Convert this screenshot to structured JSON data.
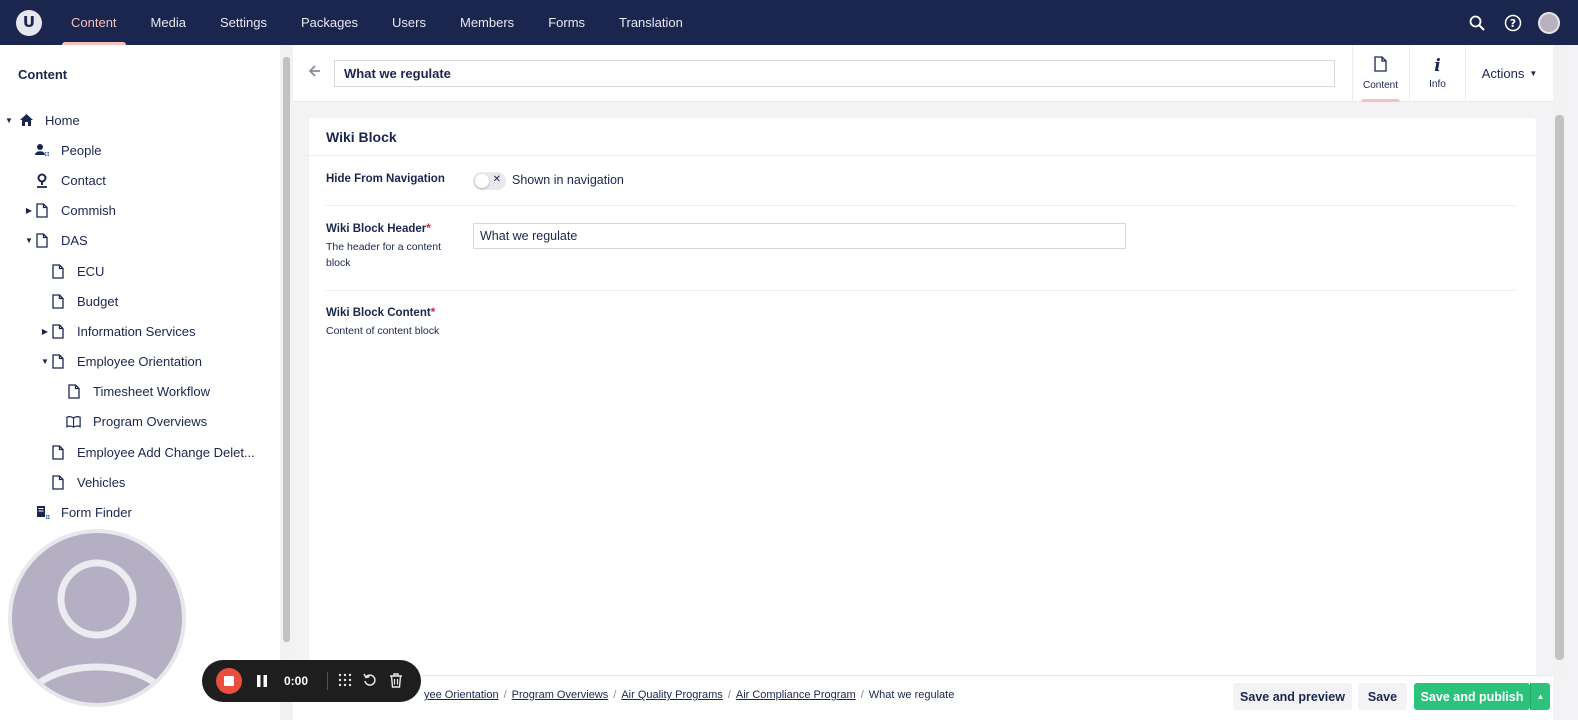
{
  "header": {
    "logo_letter": "U",
    "nav": [
      "Content",
      "Media",
      "Settings",
      "Packages",
      "Users",
      "Members",
      "Forms",
      "Translation"
    ],
    "active_nav": "Content",
    "accent": "#f5c1bc",
    "bar_color": "#1b264f"
  },
  "sidebar": {
    "title": "Content",
    "items": [
      {
        "label": "Home",
        "icon": "home-icon",
        "caret": "down"
      },
      {
        "label": "People",
        "icon": "people-icon",
        "caret": ""
      },
      {
        "label": "Contact",
        "icon": "location-icon",
        "caret": ""
      },
      {
        "label": "Commish",
        "icon": "document-icon",
        "caret": "right"
      },
      {
        "label": "DAS",
        "icon": "document-icon",
        "caret": "down"
      },
      {
        "label": "ECU",
        "icon": "document-icon",
        "caret": ""
      },
      {
        "label": "Budget",
        "icon": "document-icon",
        "caret": ""
      },
      {
        "label": "Information Services",
        "icon": "document-icon",
        "caret": "right"
      },
      {
        "label": "Employee Orientation",
        "icon": "document-icon",
        "caret": "down"
      },
      {
        "label": "Timesheet Workflow",
        "icon": "document-icon",
        "caret": ""
      },
      {
        "label": "Program Overviews",
        "icon": "book-icon",
        "caret": ""
      },
      {
        "label": "Employee Add Change Delet...",
        "icon": "document-icon",
        "caret": ""
      },
      {
        "label": "Vehicles",
        "icon": "document-icon",
        "caret": ""
      },
      {
        "label": "Form Finder",
        "icon": "form-icon",
        "caret": ""
      }
    ]
  },
  "editor": {
    "node_name": "What we regulate",
    "tabs": [
      {
        "label": "Content",
        "icon": "document-icon"
      },
      {
        "label": "Info",
        "icon": "info-icon"
      }
    ],
    "actions_label": "Actions"
  },
  "panel": {
    "title": "Wiki Block",
    "hide_nav": {
      "label": "Hide From Navigation",
      "toggle_text": "Shown in navigation",
      "on": false
    },
    "header_prop": {
      "label": "Wiki Block Header",
      "required": "*",
      "description": "The header for a content block",
      "value": "What we regulate"
    },
    "content_prop": {
      "label": "Wiki Block Content",
      "required": "*",
      "description": "Content of content block"
    }
  },
  "footer": {
    "breadcrumbs": [
      "yee Orientation",
      "Program Overviews",
      "Air Quality Programs",
      "Air Compliance Program",
      "What we regulate"
    ],
    "save_preview": "Save and preview",
    "save": "Save",
    "save_publish": "Save and publish",
    "publish_color": "#2bc37c"
  },
  "recorder": {
    "time": "0:00",
    "stop_color": "#ea4e3d"
  }
}
